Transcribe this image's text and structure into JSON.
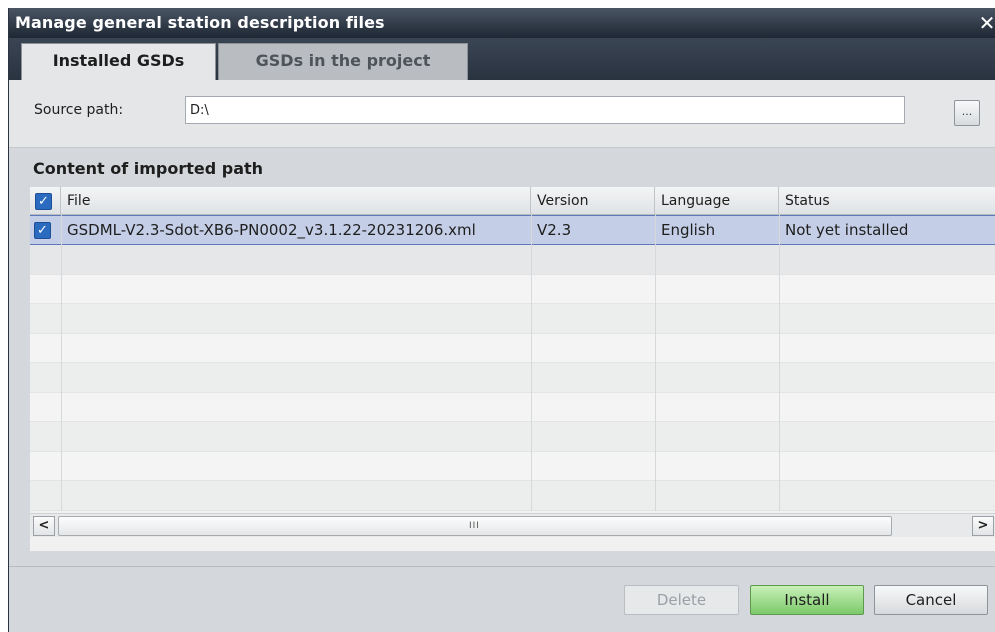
{
  "window": {
    "title": "Manage general station description files",
    "close_glyph": "✕"
  },
  "tabs": [
    {
      "label": "Installed GSDs",
      "active": true
    },
    {
      "label": "GSDs in the project",
      "active": false
    }
  ],
  "source": {
    "label": "Source path:",
    "value": "D:\\",
    "browse_label": "..."
  },
  "content": {
    "title": "Content of imported path",
    "columns": [
      "File",
      "Version",
      "Language",
      "Status"
    ],
    "header_checked": true,
    "rows": [
      {
        "checked": true,
        "file": "GSDML-V2.3-Sdot-XB6-PN0002_v3.1.22-20231206.xml",
        "version": "V2.3",
        "language": "English",
        "status": "Not yet installed"
      }
    ],
    "scrollbar": {
      "left": "<",
      "right": ">",
      "grip": "III"
    }
  },
  "buttons": {
    "delete": "Delete",
    "install": "Install",
    "cancel": "Cancel"
  },
  "colors": {
    "title_bar": "#1e2733",
    "selection": "#c4cee6",
    "install_green": "#7cc96a",
    "checkbox_blue": "#2a6bc0"
  },
  "icons": {
    "checkbox": "checkbox-checked-icon",
    "close": "close-icon"
  }
}
